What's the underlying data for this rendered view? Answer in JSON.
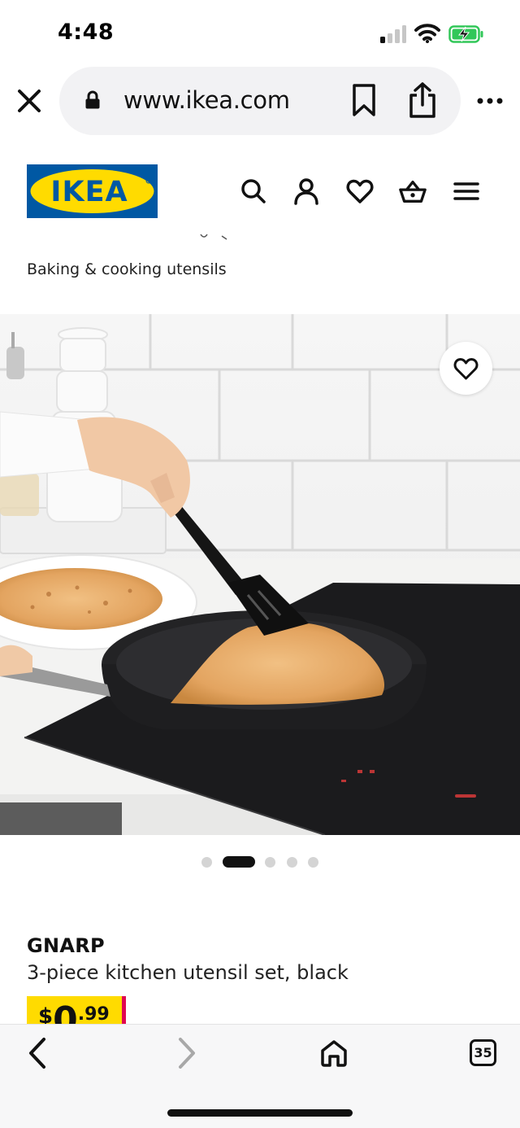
{
  "status_bar": {
    "time": "4:48",
    "icons": [
      "cellular-signal-icon",
      "wifi-icon",
      "battery-charging-icon"
    ],
    "battery_color": "#32c759"
  },
  "browser": {
    "url": "www.ikea.com",
    "icons": [
      "close-icon",
      "lock-icon",
      "bookmark-icon",
      "share-icon",
      "more-icon"
    ]
  },
  "header": {
    "logo_text": "IKEA",
    "logo_colors": {
      "blue": "#0058a3",
      "yellow": "#ffdb00"
    },
    "nav_icons": [
      "search-icon",
      "account-icon",
      "favorites-icon",
      "basket-icon",
      "menu-icon"
    ]
  },
  "breadcrumb": {
    "current": "Baking & cooking utensils"
  },
  "gallery": {
    "slide_count": 5,
    "active_slide": 2,
    "favorite_icon": "heart-icon"
  },
  "product": {
    "name": "GNARP",
    "description": "3-piece kitchen utensil set, black",
    "price": {
      "currency": "$",
      "integer": "0",
      "decimal": ".99"
    },
    "price_colors": {
      "background": "#ffdb00",
      "accent": "#e00751"
    }
  },
  "toolbar": {
    "icons": [
      "back-icon",
      "forward-icon",
      "home-icon",
      "tabs-icon"
    ],
    "tabs_count": "35"
  }
}
